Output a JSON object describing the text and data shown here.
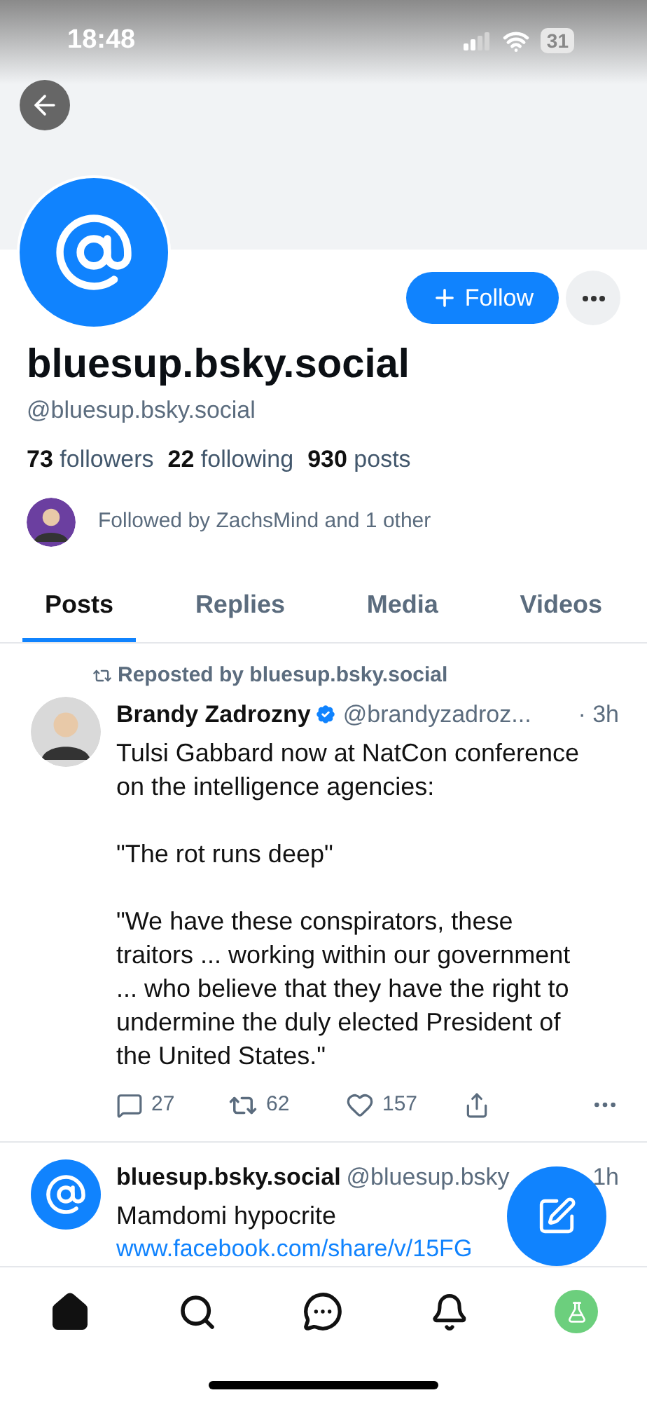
{
  "status_bar": {
    "time": "18:48",
    "battery": "31"
  },
  "profile": {
    "display_name": "bluesup.bsky.social",
    "handle": "@bluesup.bsky.social",
    "follow_button": "Follow",
    "stats": [
      {
        "count": "73",
        "label": "followers"
      },
      {
        "count": "22",
        "label": "following"
      },
      {
        "count": "930",
        "label": "posts"
      }
    ],
    "followed_by": "Followed by ZachsMind and 1 other"
  },
  "tabs": [
    {
      "label": "Posts",
      "selected": true
    },
    {
      "label": "Replies",
      "selected": false
    },
    {
      "label": "Media",
      "selected": false
    },
    {
      "label": "Videos",
      "selected": false
    }
  ],
  "posts": [
    {
      "repost_label": "Reposted by bluesup.bsky.social",
      "kind": "person",
      "author": "Brandy Zadrozny",
      "verified": true,
      "handle": "@brandyzadroz...",
      "time": "· 3h",
      "paragraphs": [
        "Tulsi Gabbard now at NatCon conference on the intelligence agencies:",
        "\"The rot runs deep\"",
        "\"We have these conspirators, these traitors ... working within our government ... who believe that they have the right to undermine the duly elected President of the United States.\""
      ],
      "replies": "27",
      "reposts": "62",
      "likes": "157"
    },
    {
      "kind": "at",
      "author": "bluesup.bsky.social",
      "handle": "@bluesup.bsky",
      "time": "1h",
      "paragraphs": [
        "Mamdomi hypocrite"
      ],
      "link": "www.facebook.com/share/v/15FG"
    }
  ],
  "nav": [
    {
      "kind": "home",
      "selected": true
    },
    {
      "kind": "search",
      "selected": false
    },
    {
      "kind": "chat",
      "selected": false
    },
    {
      "kind": "bell",
      "selected": false
    },
    {
      "kind": "profile",
      "selected": false
    }
  ]
}
